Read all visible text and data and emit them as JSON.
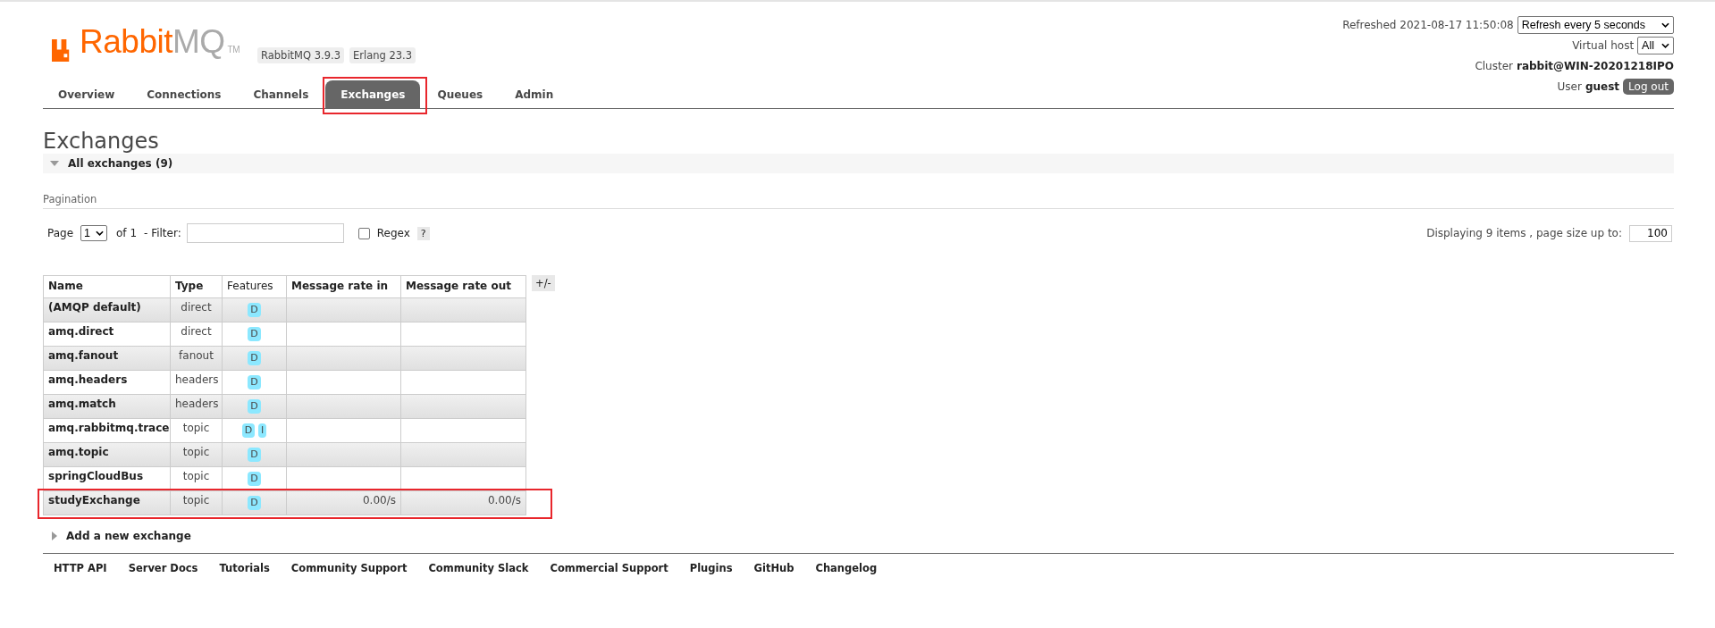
{
  "header": {
    "logo": {
      "brand": "Rabbit",
      "suffix": "MQ",
      "mark": "TM"
    },
    "versions": [
      "RabbitMQ 3.9.3",
      "Erlang 23.3"
    ],
    "refreshed": "Refreshed 2021-08-17 11:50:08",
    "refresh_select": "Refresh every 5 seconds",
    "vhost_label": "Virtual host",
    "vhost_select": "All",
    "cluster_label": "Cluster",
    "cluster_name": "rabbit@WIN-20201218IPO",
    "user_label": "User",
    "user_name": "guest",
    "logout": "Log out"
  },
  "tabs": [
    {
      "label": "Overview",
      "selected": false,
      "annotated": false
    },
    {
      "label": "Connections",
      "selected": false,
      "annotated": false
    },
    {
      "label": "Channels",
      "selected": false,
      "annotated": false
    },
    {
      "label": "Exchanges",
      "selected": true,
      "annotated": true
    },
    {
      "label": "Queues",
      "selected": false,
      "annotated": false
    },
    {
      "label": "Admin",
      "selected": false,
      "annotated": false
    }
  ],
  "page_title": "Exchanges",
  "section": {
    "title": "All exchanges (9)",
    "expanded": true
  },
  "pagination": {
    "label": "Pagination",
    "page_label": "Page",
    "page_select": "1",
    "of": "of 1",
    "filter_label": "- Filter:",
    "regex_label": "Regex",
    "regex_checked": false,
    "help": "?",
    "displaying": "Displaying 9 items , page size up to:",
    "page_size": "100"
  },
  "table": {
    "columns": [
      "Name",
      "Type",
      "Features",
      "Message rate in",
      "Message rate out"
    ],
    "toggle": "+/-",
    "rows": [
      {
        "name": "(AMQP default)",
        "type": "direct",
        "features": [
          "D"
        ],
        "annotated": false
      },
      {
        "name": "amq.direct",
        "type": "direct",
        "features": [
          "D"
        ],
        "annotated": false
      },
      {
        "name": "amq.fanout",
        "type": "fanout",
        "features": [
          "D"
        ],
        "annotated": false
      },
      {
        "name": "amq.headers",
        "type": "headers",
        "features": [
          "D"
        ],
        "annotated": false
      },
      {
        "name": "amq.match",
        "type": "headers",
        "features": [
          "D"
        ],
        "annotated": false
      },
      {
        "name": "amq.rabbitmq.trace",
        "type": "topic",
        "features": [
          "D",
          "I"
        ],
        "annotated": false
      },
      {
        "name": "amq.topic",
        "type": "topic",
        "features": [
          "D"
        ],
        "annotated": false
      },
      {
        "name": "springCloudBus",
        "type": "topic",
        "features": [
          "D"
        ],
        "annotated": false
      },
      {
        "name": "studyExchange",
        "type": "topic",
        "features": [
          "D"
        ],
        "rate_in": "0.00/s",
        "rate_out": "0.00/s",
        "annotated": true
      }
    ]
  },
  "add_section": {
    "title": "Add a new exchange",
    "expanded": false
  },
  "footer_links": [
    "HTTP API",
    "Server Docs",
    "Tutorials",
    "Community Support",
    "Community Slack",
    "Commercial Support",
    "Plugins",
    "GitHub",
    "Changelog"
  ]
}
